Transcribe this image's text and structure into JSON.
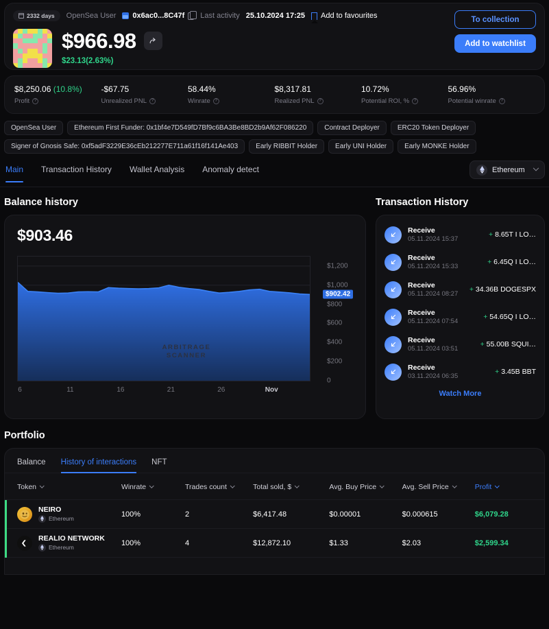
{
  "header": {
    "days_badge": "2332 days",
    "user_label": "OpenSea User",
    "address": "0x6ac0...8C47f",
    "last_activity_label": "Last activity",
    "last_activity_value": "25.10.2024 17:25",
    "favourites_label": "Add to favourites",
    "balance": "$966.98",
    "delta": "$23.13(2.63%)",
    "to_collection": "To collection",
    "add_to_watchlist": "Add to watchlist"
  },
  "stats": [
    {
      "value": "$8,250.06",
      "pct": "(10.8%)",
      "label": "Profit"
    },
    {
      "value": "-$67.75",
      "pct": "",
      "label": "Unrealized PNL"
    },
    {
      "value": "58.44%",
      "pct": "",
      "label": "Winrate"
    },
    {
      "value": "$8,317.81",
      "pct": "",
      "label": "Realized PNL"
    },
    {
      "value": "10.72%",
      "pct": "",
      "label": "Potential ROI, %"
    },
    {
      "value": "56.96%",
      "pct": "",
      "label": "Potential winrate"
    }
  ],
  "tags": [
    "OpenSea User",
    "Ethereum First Funder: 0x1bf4e7D549fD7Bf9c6BA3Be8BD2b9Af62F086220",
    "Contract Deployer",
    "ERC20 Token Deployer",
    "Signer of Gnosis Safe: 0xf5adF3229E36cEb212277E711a61f16f141Ae403",
    "Early RIBBIT Holder",
    "Early UNI Holder",
    "Early MONKE Holder"
  ],
  "nav": {
    "tabs": [
      "Main",
      "Transaction History",
      "Wallet Analysis",
      "Anomaly detect"
    ],
    "active": 0,
    "chain": "Ethereum"
  },
  "balance_history": {
    "title": "Balance history",
    "value": "$903.46",
    "watermark_line1": "ARBITRAGE",
    "watermark_line2": "SCANNER"
  },
  "chart_data": {
    "type": "area",
    "title": "Balance history",
    "xlabel": "",
    "ylabel": "",
    "ylim": [
      0,
      1300
    ],
    "yticks": [
      0,
      200,
      400,
      600,
      800,
      1000,
      1200
    ],
    "ytick_labels": [
      "0",
      "$200",
      "$400",
      "$600",
      "$800",
      "$1,000",
      "$1,200"
    ],
    "xtick_labels": [
      "6",
      "11",
      "16",
      "21",
      "26",
      "Nov"
    ],
    "xtick_positions": [
      0,
      5,
      10,
      15,
      20,
      25
    ],
    "current_value_label": "$902.42",
    "current_value": 902.42,
    "grid": true,
    "legend": "none",
    "series": [
      {
        "name": "Balance",
        "x": [
          0,
          1,
          2,
          3,
          4,
          5,
          6,
          7,
          8,
          9,
          10,
          11,
          12,
          13,
          14,
          15,
          16,
          17,
          18,
          19,
          20,
          21,
          22,
          23,
          24,
          25,
          26,
          27,
          28,
          29
        ],
        "values": [
          1030,
          935,
          930,
          922,
          915,
          918,
          930,
          932,
          930,
          975,
          968,
          965,
          962,
          965,
          972,
          1000,
          978,
          965,
          955,
          935,
          918,
          925,
          935,
          950,
          958,
          935,
          928,
          920,
          908,
          902.42
        ]
      }
    ]
  },
  "transaction_history": {
    "title": "Transaction History",
    "watch_more": "Watch More",
    "items": [
      {
        "type": "Receive",
        "date": "05.11.2024 15:37",
        "amount": "8.65T I LO…"
      },
      {
        "type": "Receive",
        "date": "05.11.2024 15:33",
        "amount": "6.45Q I LO…"
      },
      {
        "type": "Receive",
        "date": "05.11.2024 08:27",
        "amount": "34.36B DOGESPX"
      },
      {
        "type": "Receive",
        "date": "05.11.2024 07:54",
        "amount": "54.65Q I LO…"
      },
      {
        "type": "Receive",
        "date": "05.11.2024 03:51",
        "amount": "55.00B SQUI…"
      },
      {
        "type": "Receive",
        "date": "03.11.2024 06:35",
        "amount": "3.45B BBT"
      }
    ]
  },
  "portfolio": {
    "title": "Portfolio",
    "tabs": [
      "Balance",
      "History of interactions",
      "NFT"
    ],
    "active_tab": 1,
    "columns": [
      "Token",
      "Winrate",
      "Trades count",
      "Total sold, $",
      "Avg. Buy Price",
      "Avg. Sell Price",
      "Profit"
    ],
    "rows": [
      {
        "token": "NEIRO",
        "chain": "Ethereum",
        "winrate": "100%",
        "trades": "2",
        "total_sold": "$6,417.48",
        "avg_buy": "$0.00001",
        "avg_sell": "$0.000615",
        "profit": "$6,079.28"
      },
      {
        "token": "REALIO NETWORK",
        "chain": "Ethereum",
        "winrate": "100%",
        "trades": "4",
        "total_sold": "$12,872.10",
        "avg_buy": "$1.33",
        "avg_sell": "$2.03",
        "profit": "$2,599.34"
      }
    ]
  },
  "colors": {
    "accent": "#3b7dfa",
    "positive": "#2fd48a",
    "row_mark": "#3ddc84",
    "background": "#0a0a0c",
    "card": "#121215"
  }
}
